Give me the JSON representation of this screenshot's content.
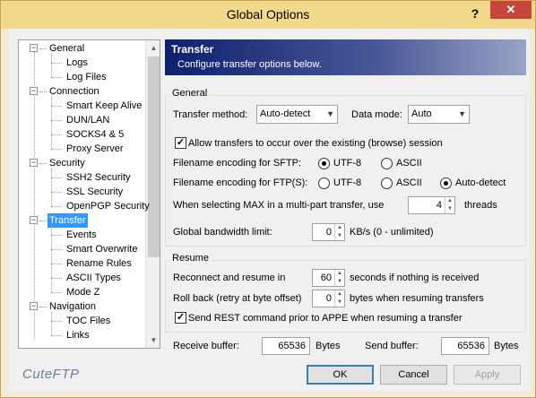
{
  "window": {
    "title": "Global Options",
    "help_glyph": "?",
    "close_glyph": "✕"
  },
  "brand": "CuteFTP",
  "tree": [
    {
      "label": "General",
      "level": 0
    },
    {
      "label": "Logs",
      "level": 1
    },
    {
      "label": "Log Files",
      "level": 1
    },
    {
      "label": "Connection",
      "level": 0
    },
    {
      "label": "Smart Keep Alive",
      "level": 1
    },
    {
      "label": "DUN/LAN",
      "level": 1
    },
    {
      "label": "SOCKS4 & 5",
      "level": 1
    },
    {
      "label": "Proxy Server",
      "level": 1
    },
    {
      "label": "Security",
      "level": 0
    },
    {
      "label": "SSH2 Security",
      "level": 1
    },
    {
      "label": "SSL Security",
      "level": 1
    },
    {
      "label": "OpenPGP Security",
      "level": 1
    },
    {
      "label": "Transfer",
      "level": 0,
      "selected": true
    },
    {
      "label": "Events",
      "level": 1
    },
    {
      "label": "Smart Overwrite",
      "level": 1
    },
    {
      "label": "Rename Rules",
      "level": 1
    },
    {
      "label": "ASCII Types",
      "level": 1
    },
    {
      "label": "Mode Z",
      "level": 1
    },
    {
      "label": "Navigation",
      "level": 0
    },
    {
      "label": "TOC Files",
      "level": 1
    },
    {
      "label": "Links",
      "level": 1
    }
  ],
  "banner": {
    "title": "Transfer",
    "subtitle": "Configure transfer options below."
  },
  "general": {
    "group_label": "General",
    "transfer_method_label": "Transfer method:",
    "transfer_method_value": "Auto-detect",
    "data_mode_label": "Data mode:",
    "data_mode_value": "Auto",
    "browse_session_label": "Allow transfers to occur over the existing (browse) session",
    "browse_session_checked": true,
    "sftp_encoding_label": "Filename encoding for SFTP:",
    "sftp_opt_utf8": "UTF-8",
    "sftp_opt_ascii": "ASCII",
    "ftp_encoding_label": "Filename encoding for FTP(S):",
    "ftp_opt_utf8": "UTF-8",
    "ftp_opt_ascii": "ASCII",
    "ftp_opt_auto": "Auto-detect",
    "max_threads_label": "When selecting MAX in a multi-part transfer, use",
    "max_threads_value": "4",
    "threads_unit": "threads",
    "bandwidth_label": "Global bandwidth limit:",
    "bandwidth_value": "0",
    "bandwidth_unit": "KB/s (0 - unlimited)"
  },
  "resume": {
    "group_label": "Resume",
    "reconnect_label": "Reconnect and resume in",
    "reconnect_value": "60",
    "reconnect_unit": "seconds if nothing is received",
    "rollback_label": "Roll back (retry at byte offset)",
    "rollback_value": "0",
    "rollback_unit": "bytes when resuming transfers",
    "rest_label": "Send REST command prior to APPE when resuming a transfer",
    "rest_checked": true
  },
  "buffers": {
    "receive_label": "Receive buffer:",
    "receive_value": "65536",
    "receive_unit": "Bytes",
    "send_label": "Send buffer:",
    "send_value": "65536",
    "send_unit": "Bytes"
  },
  "buttons": {
    "ok": "OK",
    "cancel": "Cancel",
    "apply": "Apply"
  },
  "icons": {
    "check": "✓",
    "combo_arrow": "▼",
    "expand": "−",
    "scroll_up": "▲",
    "scroll_down": "▼",
    "spin_up": "▲",
    "spin_down": "▼"
  }
}
